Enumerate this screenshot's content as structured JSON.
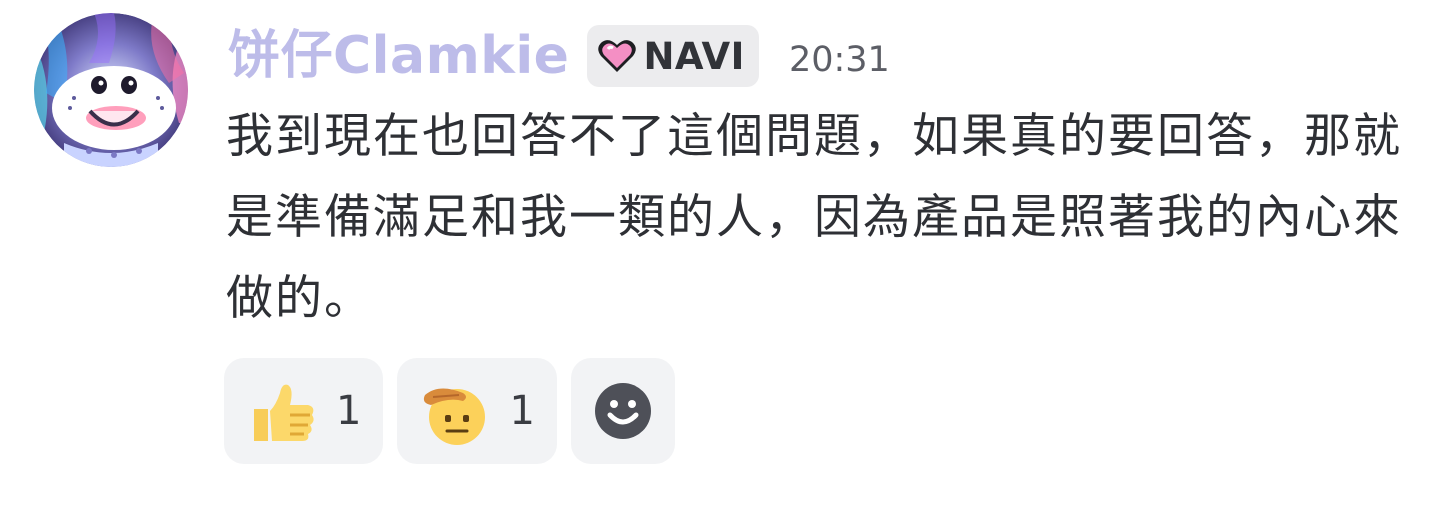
{
  "message": {
    "username": "饼仔Clamkie",
    "role": {
      "name": "NAVI",
      "icon": "pink-heart-icon",
      "color": "#f48fc4"
    },
    "timestamp": "20:31",
    "content": "我到現在也回答不了這個問題，如果真的要回答，那就是準備滿足和我一類的人，因為產品是照著我的內心來做的。",
    "username_color": "#bdbce9"
  },
  "reactions": [
    {
      "emoji": "thumbs-up-icon",
      "count": "1"
    },
    {
      "emoji": "saluting-face-icon",
      "count": "1"
    }
  ],
  "add_reaction": {
    "icon": "add-reaction-smiley-icon"
  }
}
